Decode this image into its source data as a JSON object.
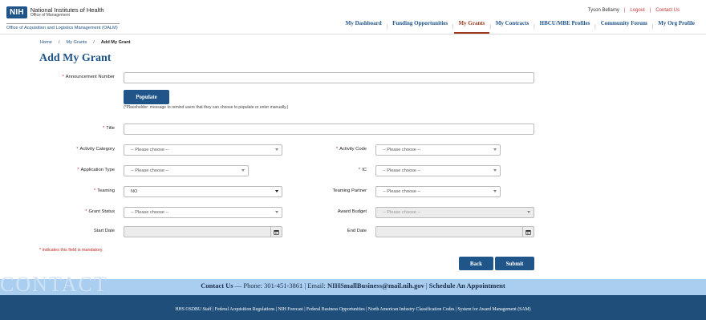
{
  "header": {
    "logo_badge": "NIH",
    "logo_line1": "National Institutes of Health",
    "logo_line2": "Office of Management",
    "org_name": "Office of Acquisition and Logistics Management (OALM)",
    "user_name": "Tyson Bellamy",
    "logout": "Logout",
    "contact_us": "Contact Us"
  },
  "nav": {
    "items": [
      {
        "label": "My Dashboard"
      },
      {
        "label": "Funding Opportunities"
      },
      {
        "label": "My Grants"
      },
      {
        "label": "My Contracts"
      },
      {
        "label": "HBCU/MBE Profiles"
      },
      {
        "label": "Community Forum"
      },
      {
        "label": "My Org Profile"
      }
    ],
    "active": "My Grants"
  },
  "breadcrumb": {
    "items": [
      "Home",
      "My Grants",
      "Add My Grant"
    ],
    "separator": "/"
  },
  "page_title": "Add My Grant",
  "form": {
    "announcement_number": {
      "label": "Announcement Number",
      "value": ""
    },
    "populate_button": "Populate",
    "populate_note": "(*Placeholder: message to remind users that they can choose to populate or enter manually.)",
    "title": {
      "label": "Title",
      "value": ""
    },
    "activity_category": {
      "label": "Activity Category",
      "value": "-- Please choose --"
    },
    "activity_code": {
      "label": "Activity Code",
      "value": "-- Please choose --"
    },
    "application_type": {
      "label": "Application Type",
      "value": "-- Please choose --"
    },
    "ic": {
      "label": "IC",
      "value": "-- Please choose --"
    },
    "teaming": {
      "label": "Teaming",
      "value": "NO"
    },
    "teaming_partner": {
      "label": "Teaming Partner",
      "value": "-- Please choose --"
    },
    "grant_status": {
      "label": "Grant Status",
      "value": "-- Please choose --"
    },
    "award_budget": {
      "label": "Award Budget",
      "value": "-- Please choose --"
    },
    "start_date": {
      "label": "Start Date",
      "value": ""
    },
    "end_date": {
      "label": "End Date",
      "value": ""
    },
    "required_marker": "*",
    "mandatory_note": "* indicates this field is mandatory.",
    "back_button": "Back",
    "submit_button": "Submit"
  },
  "contact": {
    "watermark": "CONTACT",
    "lead": "Contact Us",
    "phone": " — Phone: 301-451-3861 | Email: ",
    "email": "NIHSmallBusiness@mail.nih.gov",
    "sep": " | ",
    "appointment": "Schedule An Appointment"
  },
  "footer": {
    "links": "HHS OSDBU Staff | Federal Acquisition Regulations | NIH Forecast | Federal Business Opportunities | North American Industry Classification Codes | System for Award Management (SAM)"
  },
  "colors": {
    "primary": "#20558a",
    "active_nav": "#9b3a1a",
    "required": "#c0281d",
    "contact_band": "#a9cef0",
    "footer": "#1f4e7a"
  }
}
